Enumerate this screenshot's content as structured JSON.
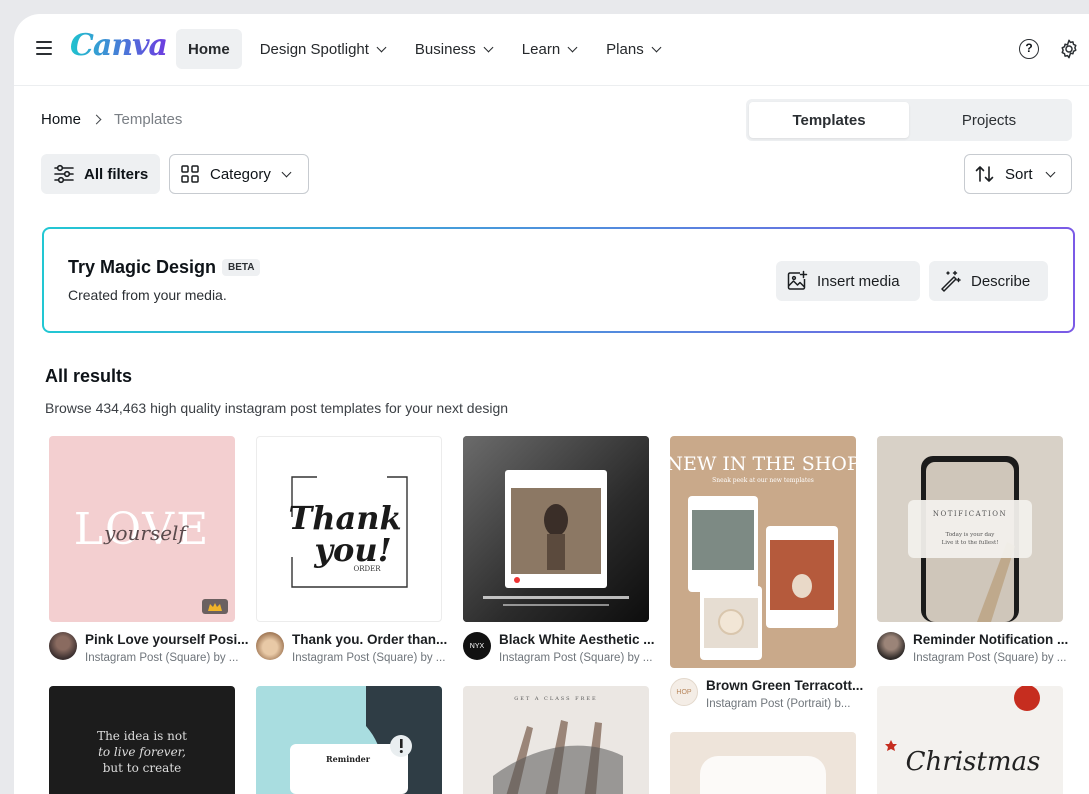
{
  "header": {
    "logo": "Canva",
    "nav": [
      {
        "label": "Home",
        "active": true,
        "dropdown": false
      },
      {
        "label": "Design Spotlight",
        "active": false,
        "dropdown": true
      },
      {
        "label": "Business",
        "active": false,
        "dropdown": true
      },
      {
        "label": "Learn",
        "active": false,
        "dropdown": true
      },
      {
        "label": "Plans",
        "active": false,
        "dropdown": true
      }
    ],
    "help_glyph": "?"
  },
  "breadcrumb": {
    "home": "Home",
    "current": "Templates"
  },
  "segmented": {
    "templates": "Templates",
    "projects": "Projects"
  },
  "filters": {
    "all_filters": "All filters",
    "category": "Category",
    "sort": "Sort"
  },
  "magic": {
    "title": "Try Magic Design",
    "badge": "BETA",
    "subtitle": "Created from your media.",
    "insert_media": "Insert media",
    "describe": "Describe"
  },
  "results": {
    "title": "All results",
    "subtitle": "Browse 434,463 high quality instagram post templates for your next design"
  },
  "cards": [
    {
      "title": "Pink Love yourself Posi...",
      "sub": "Instagram Post (Square) by ...",
      "art": {
        "big": "LOVE",
        "script": "yourself",
        "bg": "#f3cfd0"
      }
    },
    {
      "title": "Thank you. Order than...",
      "sub": "Instagram Post (Square) by ...",
      "art": {
        "line1": "Thank",
        "line2": "you!",
        "order": "ORDER"
      }
    },
    {
      "title": "Black White Aesthetic ...",
      "sub": "Instagram Post (Square) by ...",
      "avatar_text": "NYX"
    },
    {
      "title": "Brown Green Terracott...",
      "sub": "Instagram Post (Portrait) b...",
      "avatar_text": "HOP",
      "art": {
        "headline": "NEW IN THE SHOP",
        "tagline": "Sneak peek at our new templates"
      }
    },
    {
      "title": "Reminder Notification ...",
      "sub": "Instagram Post (Square) by ...",
      "art": {
        "label": "NOTIFICATION",
        "line1": "Today is your day",
        "line2": "Live it to the fullest!"
      }
    }
  ],
  "row2": {
    "quote1": "The idea is not",
    "quote2": "to live forever,",
    "quote3": "but to create",
    "reminder": "Reminder",
    "class_banner": "GET A CLASS FREE",
    "christmas": "Christmas"
  },
  "colors": {
    "accent_start": "#22c7d3",
    "accent_end": "#7b5ae6",
    "nav_active_bg": "#eef0f2"
  }
}
